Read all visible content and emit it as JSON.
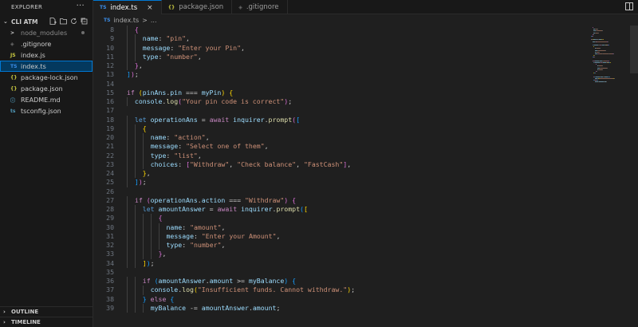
{
  "explorer": {
    "title": "EXPLORER",
    "more": "···",
    "folder": "CLI ATM",
    "files": [
      {
        "name": "node_modules",
        "icon": ">",
        "icon_color": "#cccccc",
        "dim": true,
        "dot": true,
        "selected": false
      },
      {
        "name": ".gitignore",
        "icon": "◈",
        "icon_color": "#6e6e6e",
        "dim": false,
        "dot": false,
        "selected": false
      },
      {
        "name": "index.js",
        "icon": "JS",
        "icon_color": "#cbcb41",
        "dim": false,
        "dot": false,
        "selected": false
      },
      {
        "name": "index.ts",
        "icon": "TS",
        "icon_color": "#3b8eea",
        "dim": false,
        "dot": false,
        "selected": true
      },
      {
        "name": "package-lock.json",
        "icon": "{}",
        "icon_color": "#cbcb41",
        "dim": false,
        "dot": false,
        "selected": false
      },
      {
        "name": "package.json",
        "icon": "{}",
        "icon_color": "#cbcb41",
        "dim": false,
        "dot": false,
        "selected": false
      },
      {
        "name": "README.md",
        "icon": "ⓘ",
        "icon_color": "#519aba",
        "dim": false,
        "dot": false,
        "selected": false
      },
      {
        "name": "tsconfig.json",
        "icon": "ts",
        "icon_color": "#519aba",
        "dim": false,
        "dot": false,
        "selected": false
      }
    ],
    "outline": "OUTLINE",
    "timeline": "TIMELINE"
  },
  "tabs": [
    {
      "label": "index.ts",
      "icon": "TS",
      "icon_color": "#3b8eea",
      "active": true
    },
    {
      "label": "package.json",
      "icon": "{}",
      "icon_color": "#cbcb41",
      "active": false
    },
    {
      "label": ".gitignore",
      "icon": "◈",
      "icon_color": "#6e6e6e",
      "active": false
    }
  ],
  "breadcrumb": {
    "icon": "TS",
    "file": "index.ts",
    "sep": ">",
    "more": "..."
  },
  "editor": {
    "lines": [
      {
        "n": "8",
        "indent": 1,
        "t": [
          [
            "b2",
            "{"
          ]
        ]
      },
      {
        "n": "9",
        "indent": 2,
        "t": [
          [
            "v",
            "name"
          ],
          [
            "p",
            ": "
          ],
          [
            "s",
            "\"pin\""
          ],
          [
            "p",
            ","
          ]
        ]
      },
      {
        "n": "10",
        "indent": 2,
        "t": [
          [
            "v",
            "message"
          ],
          [
            "p",
            ": "
          ],
          [
            "s",
            "\"Enter your Pin\""
          ],
          [
            "p",
            ","
          ]
        ]
      },
      {
        "n": "11",
        "indent": 2,
        "t": [
          [
            "v",
            "type"
          ],
          [
            "p",
            ": "
          ],
          [
            "s",
            "\"number\""
          ],
          [
            "p",
            ","
          ]
        ]
      },
      {
        "n": "12",
        "indent": 1,
        "t": [
          [
            "b2",
            "}"
          ],
          [
            "p",
            ","
          ]
        ]
      },
      {
        "n": "13",
        "indent": 0,
        "t": [
          [
            "b3",
            "]"
          ],
          [
            "b2",
            ")"
          ],
          [
            "p",
            ";"
          ]
        ]
      },
      {
        "n": "14",
        "indent": 0,
        "t": []
      },
      {
        "n": "15",
        "indent": 0,
        "t": [
          [
            "k",
            "if"
          ],
          [
            "p",
            " "
          ],
          [
            "b1",
            "("
          ],
          [
            "v",
            "pinAns"
          ],
          [
            "p",
            "."
          ],
          [
            "v",
            "pin"
          ],
          [
            "p",
            " === "
          ],
          [
            "v",
            "myPin"
          ],
          [
            "b1",
            ")"
          ],
          [
            "p",
            " "
          ],
          [
            "b1",
            "{"
          ]
        ]
      },
      {
        "n": "16",
        "indent": 1,
        "t": [
          [
            "v",
            "console"
          ],
          [
            "p",
            "."
          ],
          [
            "f",
            "log"
          ],
          [
            "b2",
            "("
          ],
          [
            "s",
            "\"Your pin code is correct\""
          ],
          [
            "b2",
            ")"
          ],
          [
            "p",
            ";"
          ]
        ]
      },
      {
        "n": "17",
        "indent": 0,
        "t": []
      },
      {
        "n": "18",
        "indent": 1,
        "t": [
          [
            "kw",
            "let"
          ],
          [
            "p",
            " "
          ],
          [
            "v",
            "operationAns"
          ],
          [
            "p",
            " = "
          ],
          [
            "k",
            "await"
          ],
          [
            "p",
            " "
          ],
          [
            "v",
            "inquirer"
          ],
          [
            "p",
            "."
          ],
          [
            "f",
            "prompt"
          ],
          [
            "b2",
            "("
          ],
          [
            "b3",
            "["
          ]
        ]
      },
      {
        "n": "19",
        "indent": 2,
        "t": [
          [
            "b1",
            "{"
          ]
        ]
      },
      {
        "n": "20",
        "indent": 3,
        "t": [
          [
            "v",
            "name"
          ],
          [
            "p",
            ": "
          ],
          [
            "s",
            "\"action\""
          ],
          [
            "p",
            ","
          ]
        ]
      },
      {
        "n": "21",
        "indent": 3,
        "t": [
          [
            "v",
            "message"
          ],
          [
            "p",
            ": "
          ],
          [
            "s",
            "\"Select one of them\""
          ],
          [
            "p",
            ","
          ]
        ]
      },
      {
        "n": "22",
        "indent": 3,
        "t": [
          [
            "v",
            "type"
          ],
          [
            "p",
            ": "
          ],
          [
            "s",
            "\"list\""
          ],
          [
            "p",
            ","
          ]
        ]
      },
      {
        "n": "23",
        "indent": 3,
        "t": [
          [
            "v",
            "choices"
          ],
          [
            "p",
            ": "
          ],
          [
            "b2",
            "["
          ],
          [
            "s",
            "\"Withdraw\""
          ],
          [
            "p",
            ", "
          ],
          [
            "s",
            "\"Check balance\""
          ],
          [
            "p",
            ", "
          ],
          [
            "s",
            "\"FastCash\""
          ],
          [
            "b2",
            "]"
          ],
          [
            "p",
            ","
          ]
        ]
      },
      {
        "n": "24",
        "indent": 2,
        "t": [
          [
            "b1",
            "}"
          ],
          [
            "p",
            ","
          ]
        ]
      },
      {
        "n": "25",
        "indent": 1,
        "t": [
          [
            "b3",
            "]"
          ],
          [
            "b2",
            ")"
          ],
          [
            "p",
            ";"
          ]
        ]
      },
      {
        "n": "26",
        "indent": 0,
        "t": []
      },
      {
        "n": "27",
        "indent": 1,
        "t": [
          [
            "k",
            "if"
          ],
          [
            "p",
            " "
          ],
          [
            "b2",
            "("
          ],
          [
            "v",
            "operationAns"
          ],
          [
            "p",
            "."
          ],
          [
            "v",
            "action"
          ],
          [
            "p",
            " === "
          ],
          [
            "s",
            "\"Withdraw\""
          ],
          [
            "b2",
            ")"
          ],
          [
            "p",
            " "
          ],
          [
            "b2",
            "{"
          ]
        ]
      },
      {
        "n": "28",
        "indent": 2,
        "t": [
          [
            "kw",
            "let"
          ],
          [
            "p",
            " "
          ],
          [
            "v",
            "amountAnswer"
          ],
          [
            "p",
            " = "
          ],
          [
            "k",
            "await"
          ],
          [
            "p",
            " "
          ],
          [
            "v",
            "inquirer"
          ],
          [
            "p",
            "."
          ],
          [
            "f",
            "prompt"
          ],
          [
            "b3",
            "("
          ],
          [
            "b1",
            "["
          ]
        ]
      },
      {
        "n": "29",
        "indent": 4,
        "t": [
          [
            "b2",
            "{"
          ]
        ]
      },
      {
        "n": "30",
        "indent": 5,
        "t": [
          [
            "v",
            "name"
          ],
          [
            "p",
            ": "
          ],
          [
            "s",
            "\"amount\""
          ],
          [
            "p",
            ","
          ]
        ]
      },
      {
        "n": "31",
        "indent": 5,
        "t": [
          [
            "v",
            "message"
          ],
          [
            "p",
            ": "
          ],
          [
            "s",
            "\"Enter your Amount\""
          ],
          [
            "p",
            ","
          ]
        ]
      },
      {
        "n": "32",
        "indent": 5,
        "t": [
          [
            "v",
            "type"
          ],
          [
            "p",
            ": "
          ],
          [
            "s",
            "\"number\""
          ],
          [
            "p",
            ","
          ]
        ]
      },
      {
        "n": "33",
        "indent": 4,
        "t": [
          [
            "b2",
            "}"
          ],
          [
            "p",
            ","
          ]
        ]
      },
      {
        "n": "34",
        "indent": 2,
        "t": [
          [
            "b1",
            "]"
          ],
          [
            "b3",
            ")"
          ],
          [
            "p",
            ";"
          ]
        ]
      },
      {
        "n": "35",
        "indent": 0,
        "t": []
      },
      {
        "n": "36",
        "indent": 2,
        "t": [
          [
            "k",
            "if"
          ],
          [
            "p",
            " "
          ],
          [
            "b3",
            "("
          ],
          [
            "v",
            "amountAnswer"
          ],
          [
            "p",
            "."
          ],
          [
            "v",
            "amount"
          ],
          [
            "p",
            " >= "
          ],
          [
            "v",
            "myBalance"
          ],
          [
            "b3",
            ")"
          ],
          [
            "p",
            " "
          ],
          [
            "b3",
            "{"
          ]
        ]
      },
      {
        "n": "37",
        "indent": 3,
        "t": [
          [
            "v",
            "console"
          ],
          [
            "p",
            "."
          ],
          [
            "f",
            "log"
          ],
          [
            "b1",
            "("
          ],
          [
            "s",
            "\"Insufficient funds. Cannot withdraw.\""
          ],
          [
            "b1",
            ")"
          ],
          [
            "p",
            ";"
          ]
        ]
      },
      {
        "n": "38",
        "indent": 2,
        "t": [
          [
            "b3",
            "}"
          ],
          [
            "p",
            " "
          ],
          [
            "k",
            "else"
          ],
          [
            "p",
            " "
          ],
          [
            "b3",
            "{"
          ]
        ]
      },
      {
        "n": "39",
        "indent": 3,
        "t": [
          [
            "v",
            "myBalance"
          ],
          [
            "p",
            " -= "
          ],
          [
            "v",
            "amountAnswer"
          ],
          [
            "p",
            "."
          ],
          [
            "v",
            "amount"
          ],
          [
            "p",
            ";"
          ]
        ]
      }
    ]
  }
}
